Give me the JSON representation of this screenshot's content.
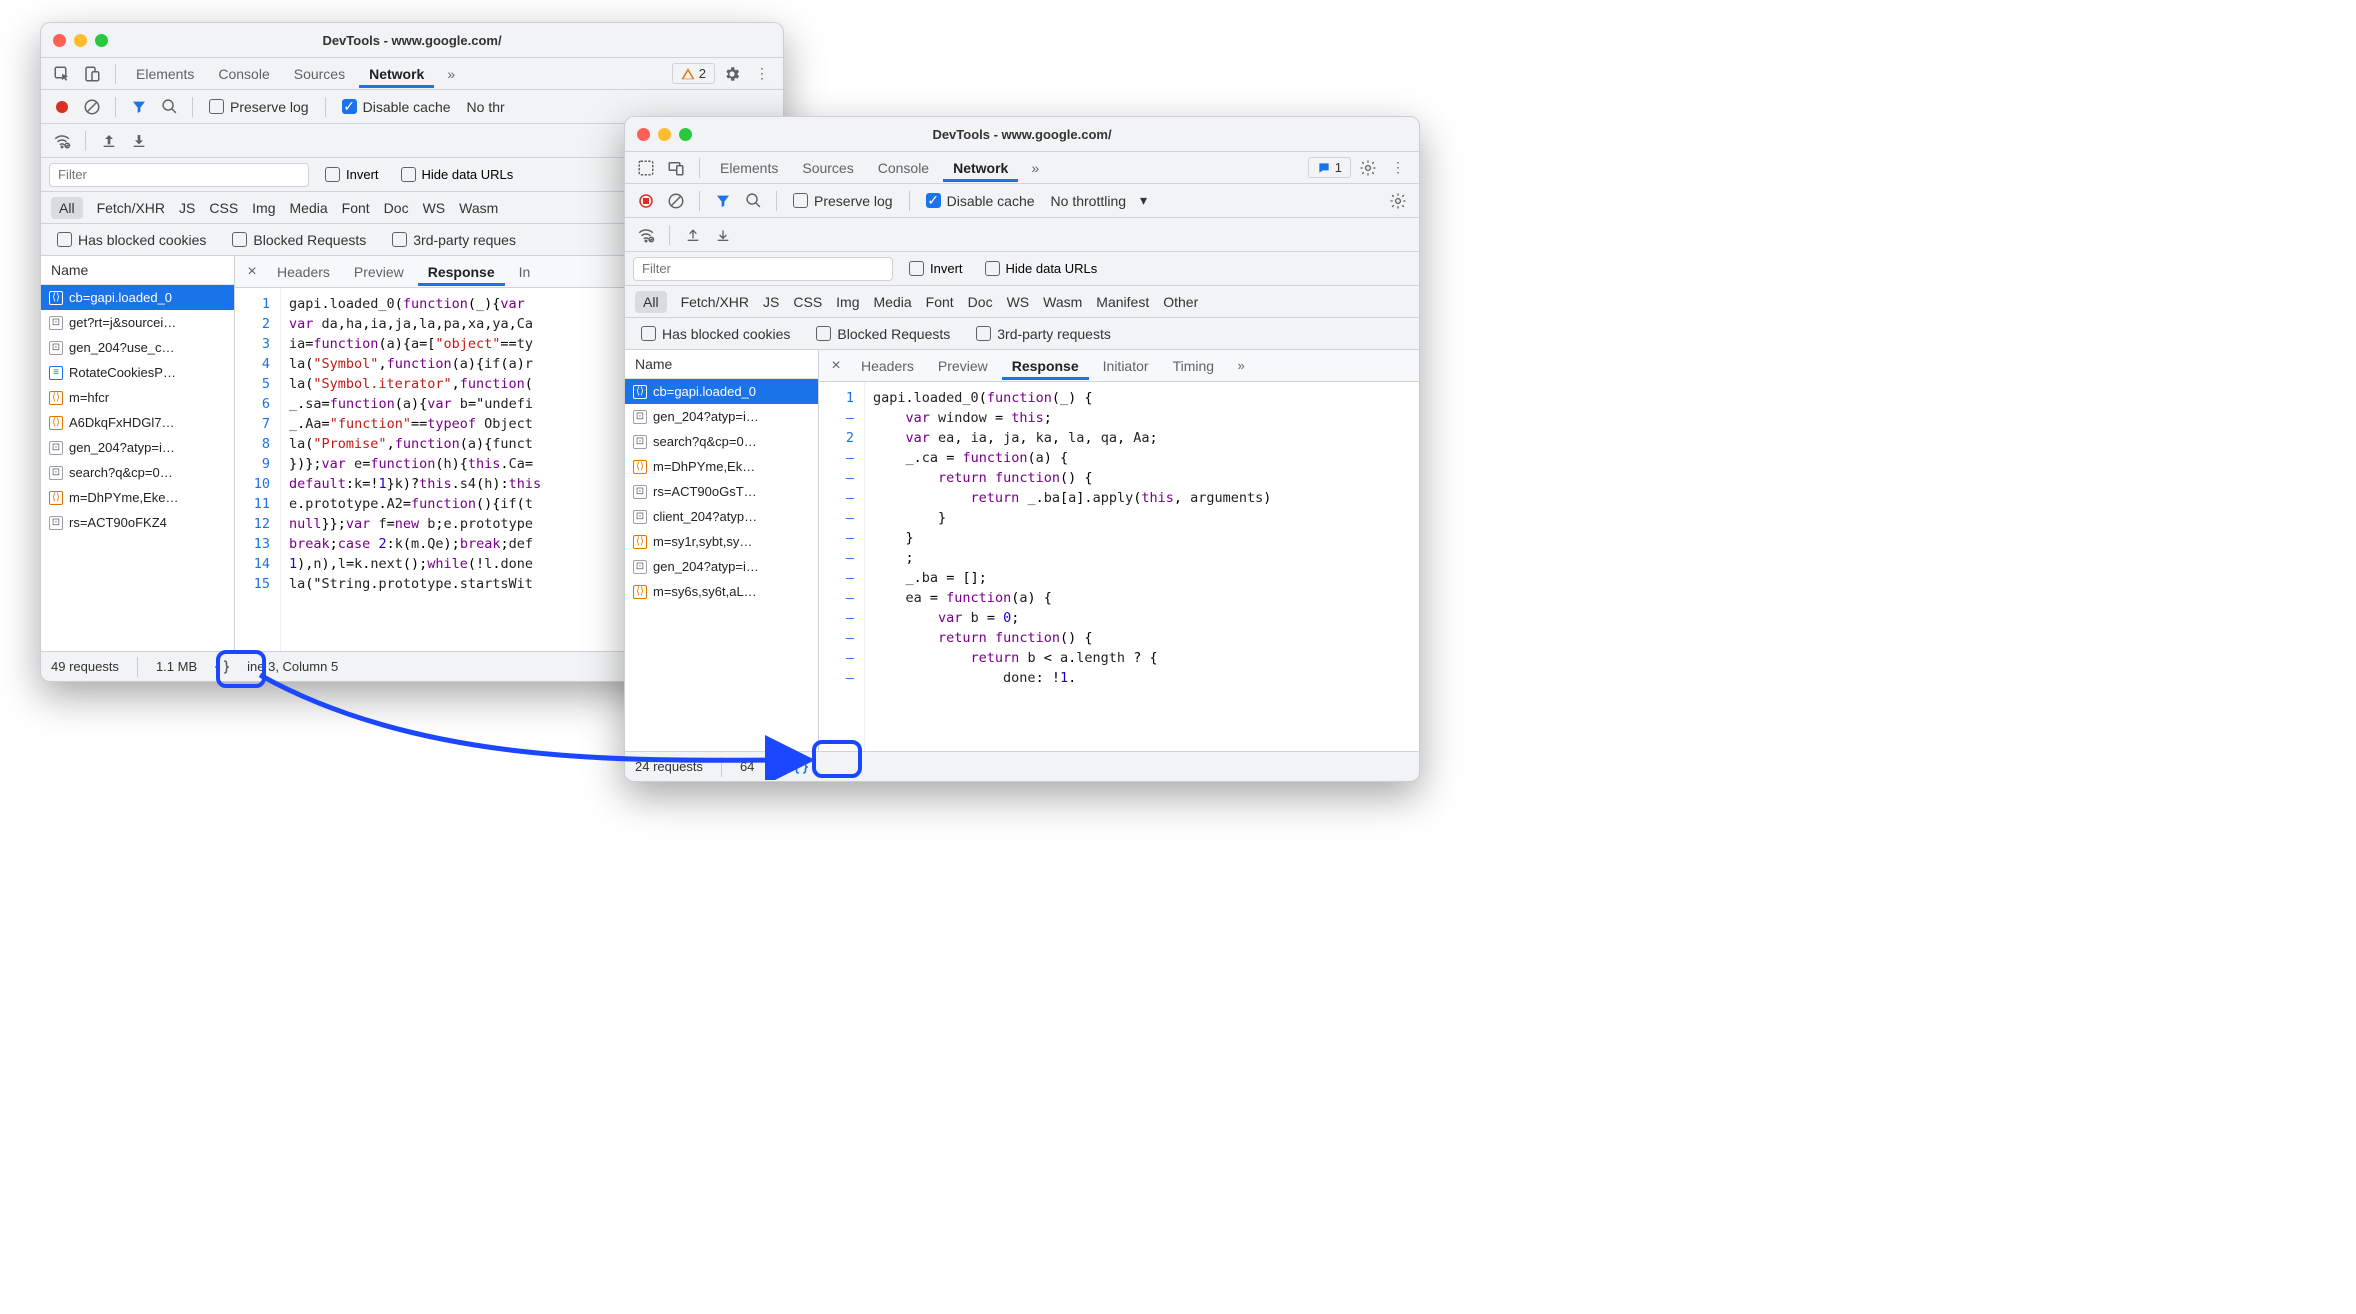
{
  "window_a": {
    "title": "DevTools - www.google.com/",
    "tabs": {
      "elements": "Elements",
      "console": "Console",
      "sources": "Sources",
      "network": "Network"
    },
    "warnings_badge": "2",
    "toolbar": {
      "preserve_log": "Preserve log",
      "disable_cache": "Disable cache",
      "throttling": "No thr"
    },
    "filter": {
      "placeholder": "Filter",
      "invert": "Invert",
      "hide_data_urls": "Hide data URLs"
    },
    "types": [
      "All",
      "Fetch/XHR",
      "JS",
      "CSS",
      "Img",
      "Media",
      "Font",
      "Doc",
      "WS",
      "Wasm"
    ],
    "filters2": {
      "blocked_cookies": "Has blocked cookies",
      "blocked_requests": "Blocked Requests",
      "third_party": "3rd-party reques"
    },
    "name_header": "Name",
    "files": [
      {
        "label": "cb=gapi.loaded_0",
        "kind": "js",
        "sel": true
      },
      {
        "label": "get?rt=j&sourcei…",
        "kind": "gen"
      },
      {
        "label": "gen_204?use_c…",
        "kind": "gen"
      },
      {
        "label": "RotateCookiesP…",
        "kind": "doc"
      },
      {
        "label": "m=hfcr",
        "kind": "js"
      },
      {
        "label": "A6DkqFxHDGl7…",
        "kind": "js"
      },
      {
        "label": "gen_204?atyp=i…",
        "kind": "gen"
      },
      {
        "label": "search?q&cp=0…",
        "kind": "gen"
      },
      {
        "label": "m=DhPYme,Eke…",
        "kind": "js"
      },
      {
        "label": "rs=ACT90oFKZ4",
        "kind": "gen"
      }
    ],
    "detail_tabs": {
      "headers": "Headers",
      "preview": "Preview",
      "response": "Response",
      "initiator": "In"
    },
    "code_lines": [
      "gapi.loaded_0(function(_){var ",
      "var da,ha,ia,ja,la,pa,xa,ya,Ca",
      "ia=function(a){a=[\"object\"==ty",
      "la(\"Symbol\",function(a){if(a)r",
      "la(\"Symbol.iterator\",function(",
      "_.sa=function(a){var b=\"undefi",
      "_.Aa=\"function\"==typeof Object",
      "la(\"Promise\",function(a){funct",
      "})};var e=function(h){this.Ca=",
      "default:k=!1}k)?this.s4(h):this",
      "e.prototype.A2=function(){if(t",
      "null}};var f=new b;e.prototype",
      "break;case 2:k(m.Qe);break;def",
      "1),n),l=k.next();while(!l.done",
      "la(\"String.prototype.startsWit"
    ],
    "status": {
      "requests": "49 requests",
      "transfer": "1.1 MB",
      "cursor": "ine 3, Column 5"
    }
  },
  "window_b": {
    "title": "DevTools - www.google.com/",
    "tabs": {
      "elements": "Elements",
      "sources": "Sources",
      "console": "Console",
      "network": "Network"
    },
    "msg_badge": "1",
    "toolbar": {
      "preserve_log": "Preserve log",
      "disable_cache": "Disable cache",
      "throttling": "No throttling"
    },
    "filter": {
      "placeholder": "Filter",
      "invert": "Invert",
      "hide_data_urls": "Hide data URLs"
    },
    "types": [
      "All",
      "Fetch/XHR",
      "JS",
      "CSS",
      "Img",
      "Media",
      "Font",
      "Doc",
      "WS",
      "Wasm",
      "Manifest",
      "Other"
    ],
    "filters2": {
      "blocked_cookies": "Has blocked cookies",
      "blocked_requests": "Blocked Requests",
      "third_party": "3rd-party requests"
    },
    "name_header": "Name",
    "files": [
      {
        "label": "cb=gapi.loaded_0",
        "kind": "js",
        "sel": true
      },
      {
        "label": "gen_204?atyp=i…",
        "kind": "gen"
      },
      {
        "label": "search?q&cp=0…",
        "kind": "gen"
      },
      {
        "label": "m=DhPYme,Ek…",
        "kind": "js"
      },
      {
        "label": "rs=ACT90oGsT…",
        "kind": "gen"
      },
      {
        "label": "client_204?atyp…",
        "kind": "gen"
      },
      {
        "label": "m=sy1r,sybt,sy…",
        "kind": "js"
      },
      {
        "label": "gen_204?atyp=i…",
        "kind": "gen"
      },
      {
        "label": "m=sy6s,sy6t,aL…",
        "kind": "js"
      }
    ],
    "detail_tabs": {
      "headers": "Headers",
      "preview": "Preview",
      "response": "Response",
      "initiator": "Initiator",
      "timing": "Timing"
    },
    "gutter": [
      "1",
      "–",
      "2",
      "–",
      "–",
      "–",
      "–",
      "–",
      "–",
      "–",
      "–",
      "–",
      "–",
      "–",
      "–"
    ],
    "code_lines": [
      "gapi.loaded_0(function(_) {",
      "    var window = this;",
      "    var ea, ia, ja, ka, la, qa, Aa;",
      "    _.ca = function(a) {",
      "        return function() {",
      "            return _.ba[a].apply(this, arguments)",
      "        }",
      "    }",
      "    ;",
      "    _.ba = [];",
      "    ea = function(a) {",
      "        var b = 0;",
      "        return function() {",
      "            return b < a.length ? {",
      "                done: !1."
    ],
    "status": {
      "requests": "24 requests",
      "transfer": "64"
    }
  }
}
